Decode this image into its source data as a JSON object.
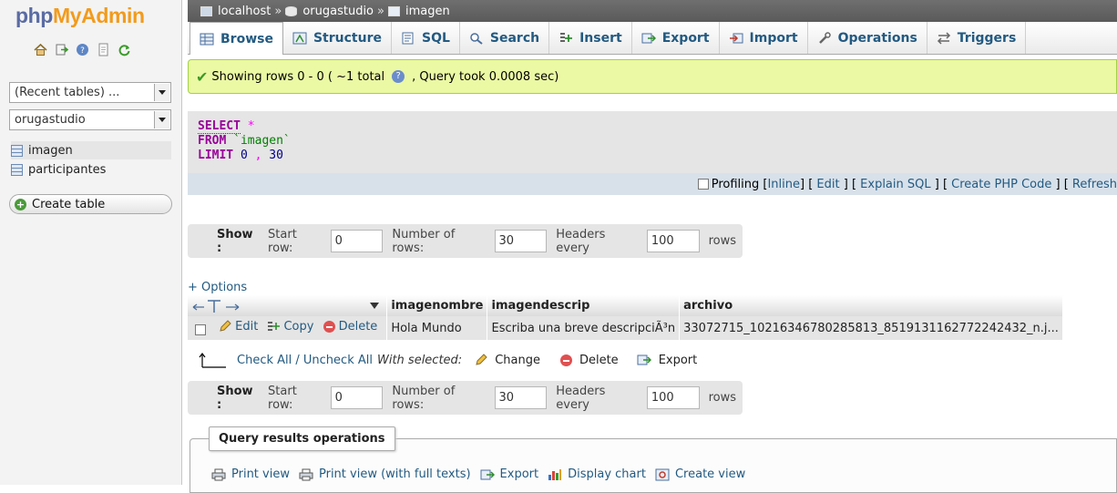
{
  "logo": {
    "php": "php",
    "my": "My",
    "admin": "Admin"
  },
  "nav": {
    "recent_tables": "(Recent tables) ...",
    "database": "orugastudio",
    "tables": [
      "imagen",
      "participantes"
    ],
    "create_table": "Create table"
  },
  "breadcrumb": {
    "server": "localhost",
    "sep": "»",
    "db": "orugastudio",
    "table": "imagen"
  },
  "tabs": {
    "browse": "Browse",
    "structure": "Structure",
    "sql": "SQL",
    "search": "Search",
    "insert": "Insert",
    "export": "Export",
    "import": "Import",
    "operations": "Operations",
    "triggers": "Triggers"
  },
  "message": {
    "text": "Showing rows 0 - 0 ( ~1 total",
    "time": ", Query took 0.0008 sec)"
  },
  "sql": {
    "select": "SELECT",
    "star": "*",
    "from": "FROM",
    "table": "`imagen`",
    "limit": "LIMIT",
    "offset": "0",
    "comma": ",",
    "count": "30"
  },
  "sqlbar": {
    "profiling": "Profiling",
    "inline": "Inline",
    "edit": "Edit",
    "explain": "Explain SQL",
    "php": "Create PHP Code",
    "refresh": "Refresh"
  },
  "navbar": {
    "show": "Show :",
    "start_row_label": "Start row:",
    "start_row": "0",
    "num_rows_label": "Number of rows:",
    "num_rows": "30",
    "headers_label": "Headers every",
    "headers": "100",
    "rows": "rows"
  },
  "options_link": "+ Options",
  "table": {
    "columns": [
      "imagenombre",
      "imagendescrip",
      "archivo"
    ],
    "row": {
      "edit": "Edit",
      "copy": "Copy",
      "delete": "Delete",
      "imagenombre": "Hola Mundo",
      "imagendescrip": "Escriba una breve descripciÃ³n",
      "archivo": "33072715_10216346780285813_8519131162772242432_n.j..."
    }
  },
  "with_selected": {
    "check_all": "Check All",
    "sep": " / ",
    "uncheck_all": "Uncheck All",
    "label": "With selected:",
    "change": "Change",
    "delete": "Delete",
    "export": "Export"
  },
  "query_ops": {
    "legend": "Query results operations",
    "print_view": "Print view",
    "print_full": "Print view (with full texts)",
    "export": "Export",
    "display_chart": "Display chart",
    "create_view": "Create view"
  },
  "colors": {
    "accent": "#235a81",
    "success_bg": "#ebf8a4",
    "keyword": "#990099"
  }
}
